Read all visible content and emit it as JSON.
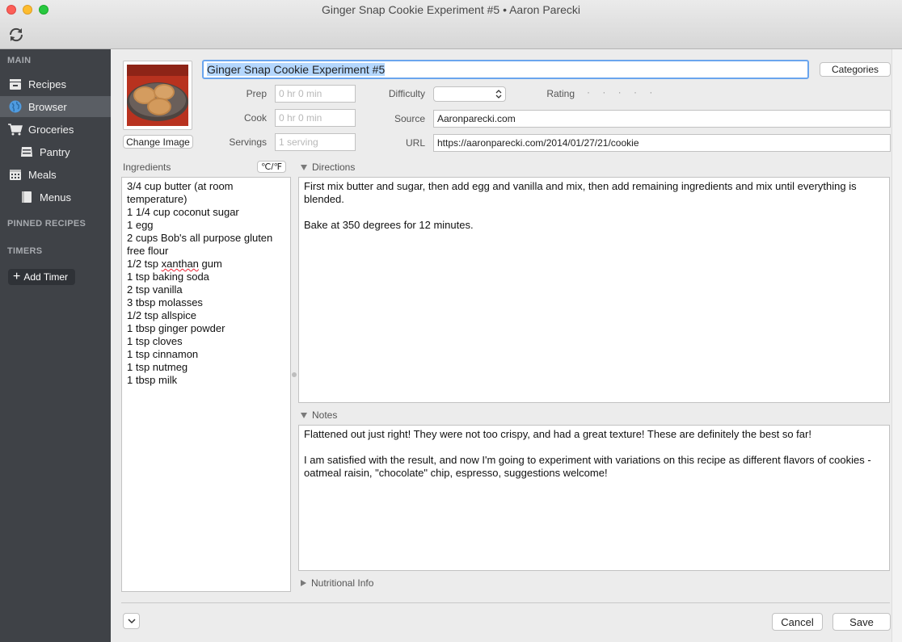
{
  "window": {
    "title": "Ginger Snap Cookie Experiment #5 • Aaron Parecki"
  },
  "sidebar": {
    "sections": {
      "main": "MAIN",
      "pinned": "PINNED RECIPES",
      "timers": "TIMERS"
    },
    "items": [
      {
        "label": "Recipes",
        "icon": "recipes-icon"
      },
      {
        "label": "Browser",
        "icon": "globe-icon"
      },
      {
        "label": "Groceries",
        "icon": "cart-icon"
      },
      {
        "label": "Pantry",
        "icon": "pantry-icon"
      },
      {
        "label": "Meals",
        "icon": "calendar-icon"
      },
      {
        "label": "Menus",
        "icon": "menu-book-icon"
      }
    ],
    "add_timer": "Add Timer"
  },
  "recipe": {
    "title": "Ginger Snap Cookie Experiment #5",
    "change_image": "Change Image",
    "categories": "Categories",
    "prep": {
      "label": "Prep",
      "placeholder": "0 hr 0 min"
    },
    "cook": {
      "label": "Cook",
      "placeholder": "0 hr 0 min"
    },
    "servings": {
      "label": "Servings",
      "placeholder": "1 serving"
    },
    "difficulty": {
      "label": "Difficulty",
      "value": ""
    },
    "rating": {
      "label": "Rating",
      "value": "· · · · ·"
    },
    "source": {
      "label": "Source",
      "value": "Aaronparecki.com"
    },
    "url": {
      "label": "URL",
      "value": "https://aaronparecki.com/2014/01/27/21/cookie"
    }
  },
  "ingredients": {
    "label": "Ingredients",
    "unit_toggle": "℃/℉",
    "items": [
      "3/4 cup butter (at room temperature)",
      "1 1/4 cup coconut sugar",
      "1 egg",
      "2 cups Bob's all purpose gluten free flour",
      "1/2 tsp xanthan gum",
      "1 tsp baking soda",
      "2 tsp vanilla",
      "3 tbsp molasses",
      "1/2 tsp allspice",
      "1 tbsp ginger powder",
      "1 tsp cloves",
      "1 tsp cinnamon",
      "1 tsp nutmeg",
      "1 tbsp milk"
    ]
  },
  "directions": {
    "label": "Directions",
    "paragraphs": [
      "First mix butter and sugar, then add egg and vanilla and mix, then add remaining ingredients and mix until everything is blended.",
      "Bake at 350 degrees for 12 minutes."
    ]
  },
  "notes": {
    "label": "Notes",
    "paragraphs": [
      "Flattened out just right! They were not too crispy, and had a great texture! These are definitely the best so far!",
      "I am satisfied with the result, and now I'm going to experiment with variations on this recipe as different flavors of cookies - oatmeal raisin, \"chocolate\" chip, espresso, suggestions welcome!"
    ]
  },
  "nutritional_info": {
    "label": "Nutritional Info"
  },
  "footer": {
    "cancel": "Cancel",
    "save": "Save"
  }
}
